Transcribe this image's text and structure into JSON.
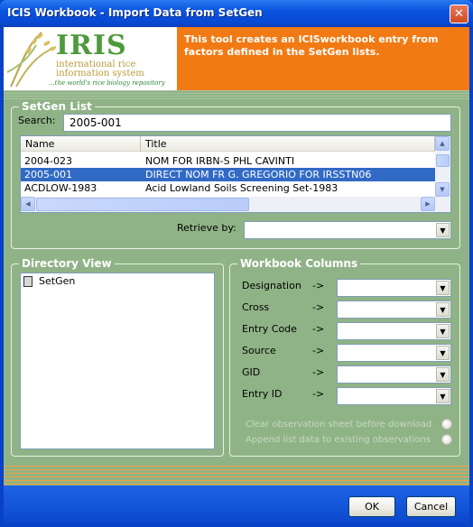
{
  "window": {
    "title": "ICIS Workbook - Import Data from SetGen",
    "close_icon": "close-icon"
  },
  "banner": {
    "logo_word": "IRIS",
    "logo_line1": "international rice",
    "logo_line2": "information system",
    "logo_tagline": "...the world's rice biology repository",
    "description": "This tool creates an ICISworkbook entry from factors defined in the SetGen lists.",
    "accent_color": "#f27a14"
  },
  "setgen": {
    "group_title": "SetGen List",
    "search_label": "Search:",
    "search_value": "2005-001",
    "columns": [
      "Name",
      "Title"
    ],
    "rows": [
      {
        "name": "2004-023",
        "title": "NOM FOR IRBN-S PHL CAVINTI",
        "selected": false
      },
      {
        "name": "2005-001",
        "title": "DIRECT NOM FR G. GREGORIO FOR IRSSTN06",
        "selected": true
      },
      {
        "name": "ACDLOW-1983",
        "title": "Acid Lowland Soils Screening Set-1983",
        "selected": false
      }
    ],
    "retrieve_label": "Retrieve by:",
    "retrieve_value": ""
  },
  "directory": {
    "group_title": "Directory View",
    "root_item": "SetGen",
    "root_icon": "folder-icon"
  },
  "workbook": {
    "group_title": "Workbook Columns",
    "arrow": "->",
    "fields": [
      {
        "label": "Designation",
        "value": ""
      },
      {
        "label": "Cross",
        "value": ""
      },
      {
        "label": "Entry Code",
        "value": ""
      },
      {
        "label": "Source",
        "value": ""
      },
      {
        "label": "GID",
        "value": ""
      },
      {
        "label": "Entry ID",
        "value": ""
      }
    ],
    "option_clear": "Clear observation sheet before download",
    "option_append": "Append list data to existing observations"
  },
  "buttons": {
    "ok": "OK",
    "cancel": "Cancel"
  }
}
